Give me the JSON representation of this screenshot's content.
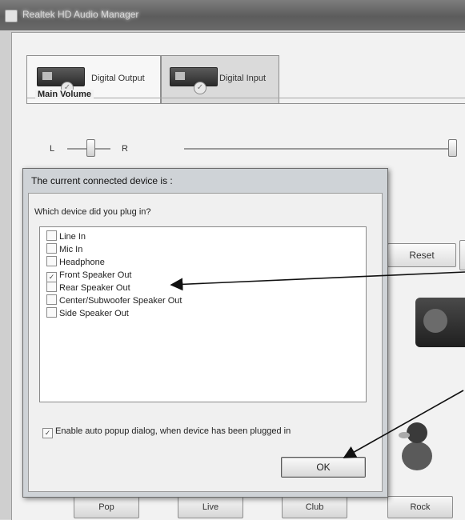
{
  "window": {
    "title": "Realtek HD Audio Manager"
  },
  "tabs": [
    {
      "label": "Digital Output"
    },
    {
      "label": "Digital Input"
    }
  ],
  "main_volume": {
    "label": "Main Volume",
    "left_label": "L",
    "right_label": "R",
    "balance_position": 0.5,
    "volume_level": 1.0
  },
  "side_button": {
    "reset_label": "Reset"
  },
  "eq_presets": [
    {
      "label": "Pop"
    },
    {
      "label": "Live"
    },
    {
      "label": "Club"
    },
    {
      "label": "Rock"
    }
  ],
  "dialog": {
    "title": "The current connected device is :",
    "question": "Which device did you plug in?",
    "devices": [
      {
        "label": "Line In",
        "checked": false
      },
      {
        "label": "Mic In",
        "checked": false
      },
      {
        "label": "Headphone",
        "checked": false
      },
      {
        "label": "Front Speaker Out",
        "checked": true
      },
      {
        "label": "Rear Speaker Out",
        "checked": false
      },
      {
        "label": "Center/Subwoofer Speaker Out",
        "checked": false
      },
      {
        "label": "Side Speaker Out",
        "checked": false
      }
    ],
    "auto_popup_label": "Enable auto popup dialog, when device has been plugged in",
    "auto_popup_checked": true,
    "ok_label": "OK"
  },
  "colors": {
    "arrow": "#111111",
    "dialog_background": "#cfd3d7",
    "window_background": "#f2f2f2"
  },
  "icons": [
    "digital-output-device-icon",
    "digital-input-device-icon",
    "speaker-icon",
    "duck-mascot-icon",
    "arrow-annotation"
  ]
}
